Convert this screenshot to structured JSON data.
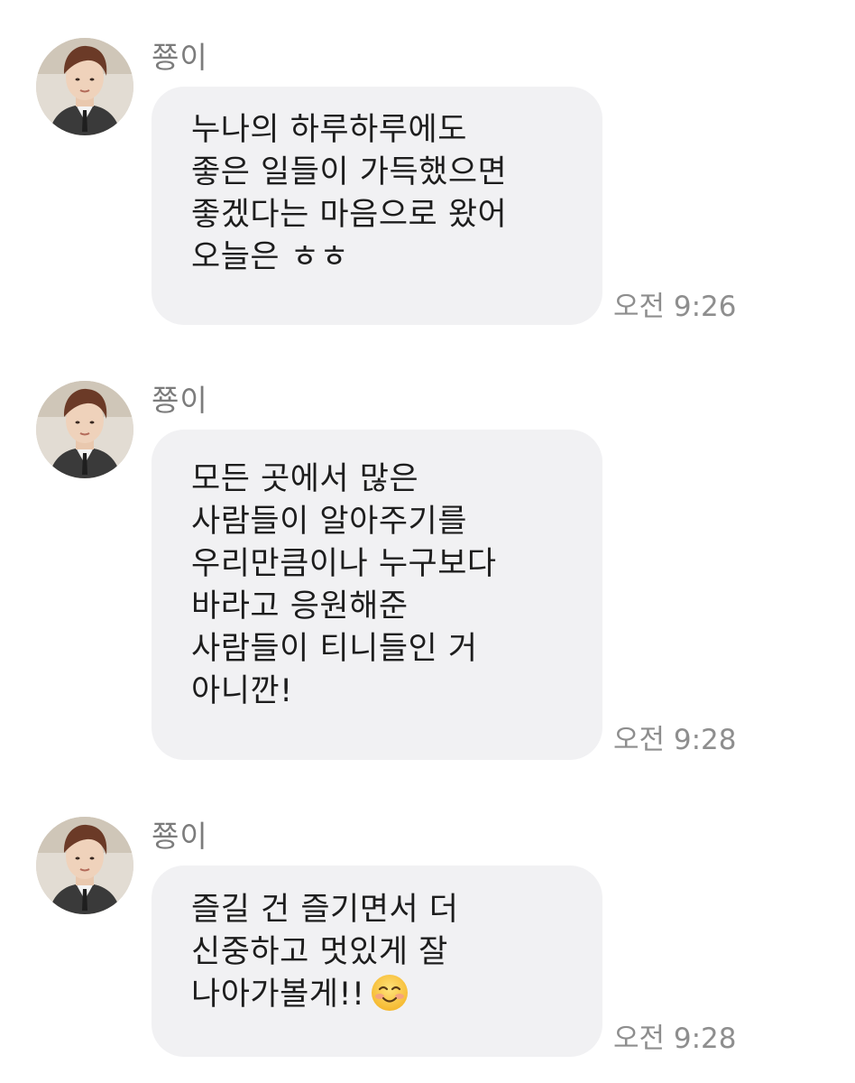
{
  "messages": [
    {
      "sender": "쭁이",
      "lines": [
        "누나의 하루하루에도",
        "좋은 일들이 가득했으면",
        "좋겠다는 마음으로 왔어",
        "오늘은 ㅎㅎ"
      ],
      "time": "오전 9:26"
    },
    {
      "sender": "쭁이",
      "lines": [
        "모든 곳에서 많은",
        "사람들이 알아주기를",
        "우리만큼이나 누구보다",
        "바라고 응원해준",
        "사람들이 티니들인 거",
        "아니깐!"
      ],
      "time": "오전 9:28"
    },
    {
      "sender": "쭁이",
      "lines": [
        "즐길 건 즐기면서 더",
        "신중하고 멋있게 잘",
        "나아가볼게!!"
      ],
      "emoji": "smiling-face-icon",
      "time": "오전 9:28"
    }
  ],
  "colors": {
    "bubble": "#f1f1f3",
    "text": "#1d1d1d",
    "sender": "#7c7c7c",
    "time": "#8e8e8e"
  }
}
